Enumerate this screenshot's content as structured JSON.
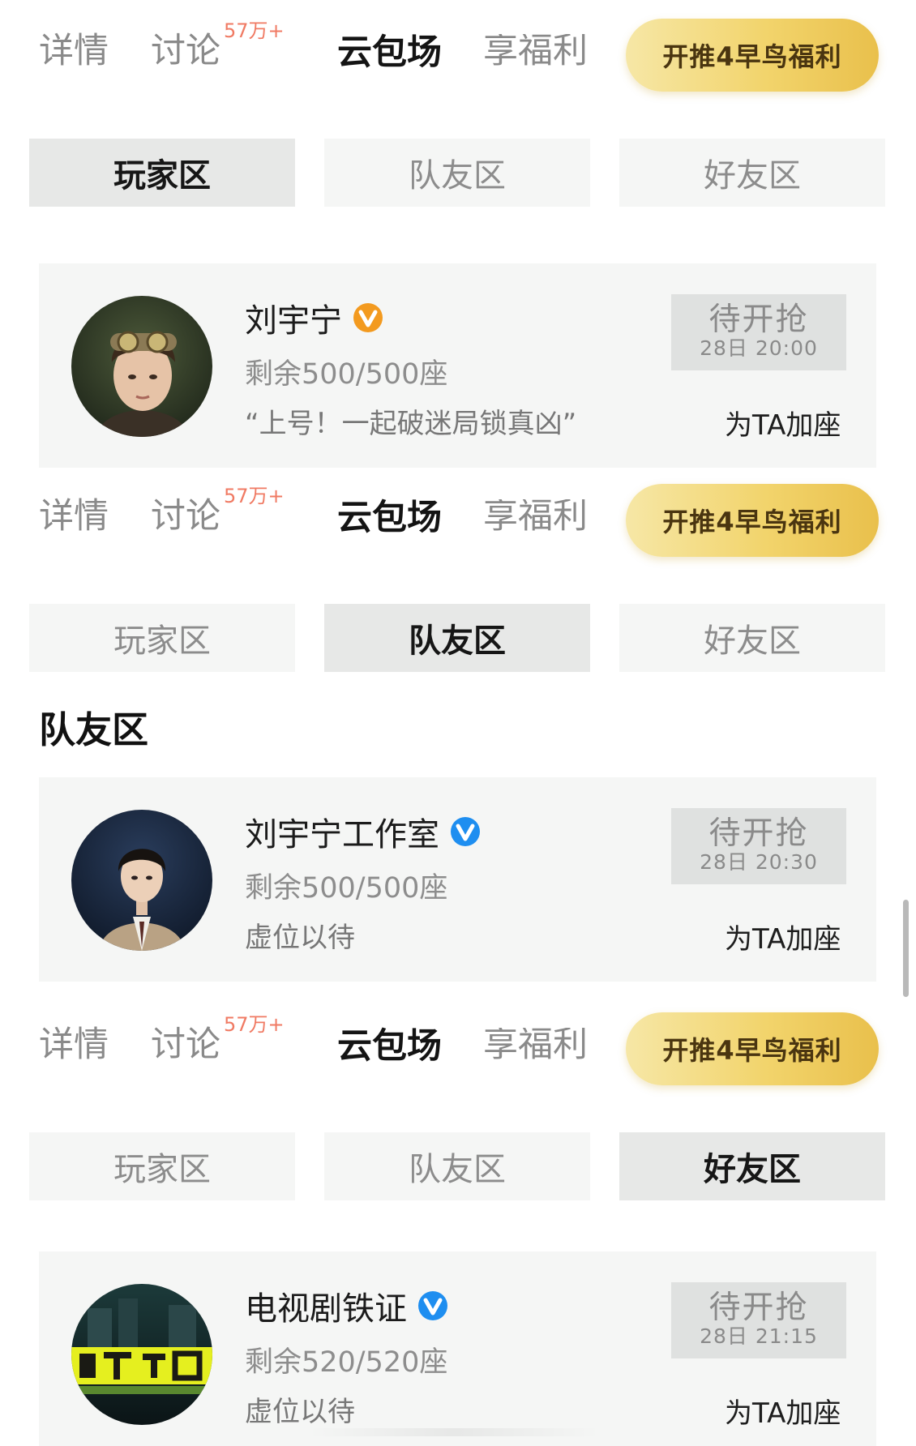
{
  "header_tabs": [
    {
      "label": "详情",
      "badge": ""
    },
    {
      "label": "讨论",
      "badge": "57万+"
    },
    {
      "label": "云包场",
      "badge": ""
    },
    {
      "label": "享福利",
      "badge": ""
    }
  ],
  "promo_button_label": "开推4早鸟福利",
  "zones": [
    "玩家区",
    "队友区",
    "好友区"
  ],
  "panels": [
    {
      "active_zone": "玩家区",
      "section_title": "",
      "card": {
        "name": "刘宇宁",
        "verified_badge": "orange-v-icon",
        "seats": "剩余500/500座",
        "quote": "“上号！一起破迷局锁真凶”",
        "status": "待开抢",
        "time": "28日 20:00",
        "action": "为TA加座"
      }
    },
    {
      "active_zone": "队友区",
      "section_title": "队友区",
      "card": {
        "name": "刘宇宁工作室",
        "verified_badge": "blue-v-icon",
        "seats": "剩余500/500座",
        "quote": "虚位以待",
        "status": "待开抢",
        "time": "28日 20:30",
        "action": "为TA加座"
      }
    },
    {
      "active_zone": "好友区",
      "section_title": "",
      "card": {
        "name": "电视剧铁证",
        "verified_badge": "blue-v-icon",
        "seats": "剩余520/520座",
        "quote": "虚位以待",
        "status": "待开抢",
        "time": "28日 21:15",
        "action": "为TA加座"
      }
    }
  ],
  "colors": {
    "badge_text": "#f07a63",
    "promo_gradient_start": "#f6e7a6",
    "promo_gradient_end": "#e9c04c",
    "verified_orange": "#f39a1f",
    "verified_blue": "#1e8ef0",
    "zone_active_bg": "#e7e8e7",
    "card_bg": "#f5f6f5"
  }
}
